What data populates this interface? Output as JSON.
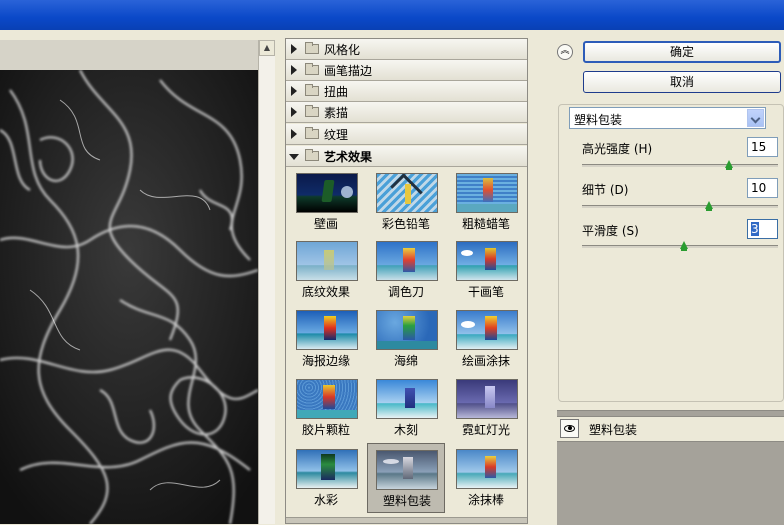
{
  "gallery": {
    "categories": [
      {
        "label": "风格化",
        "open": false
      },
      {
        "label": "画笔描边",
        "open": false
      },
      {
        "label": "扭曲",
        "open": false
      },
      {
        "label": "素描",
        "open": false
      },
      {
        "label": "纹理",
        "open": false
      },
      {
        "label": "艺术效果",
        "open": true
      }
    ],
    "thumbnails": [
      {
        "label": "壁画",
        "selected": false
      },
      {
        "label": "彩色铅笔",
        "selected": false
      },
      {
        "label": "粗糙蜡笔",
        "selected": false
      },
      {
        "label": "底纹效果",
        "selected": false
      },
      {
        "label": "调色刀",
        "selected": false
      },
      {
        "label": "干画笔",
        "selected": false
      },
      {
        "label": "海报边缘",
        "selected": false
      },
      {
        "label": "海绵",
        "selected": false
      },
      {
        "label": "绘画涂抹",
        "selected": false
      },
      {
        "label": "胶片颗粒",
        "selected": false
      },
      {
        "label": "木刻",
        "selected": false
      },
      {
        "label": "霓虹灯光",
        "selected": false
      },
      {
        "label": "水彩",
        "selected": false
      },
      {
        "label": "塑料包装",
        "selected": true
      },
      {
        "label": "涂抹棒",
        "selected": false
      }
    ]
  },
  "buttons": {
    "ok": "确定",
    "cancel": "取消"
  },
  "filter_select": {
    "value": "塑料包装"
  },
  "params": [
    {
      "label": "高光强度 (H)",
      "value": "15",
      "fraction": 0.75,
      "focused": false
    },
    {
      "label": "细节 (D)",
      "value": "10",
      "fraction": 0.65,
      "focused": false
    },
    {
      "label": "平滑度 (S)",
      "value": "3",
      "fraction": 0.52,
      "focused": true
    }
  ],
  "layers": [
    {
      "label": "塑料包装",
      "visible": true
    }
  ],
  "colors": {
    "titlebar": "#0a48c8",
    "panel": "#ece9d8",
    "slider_knob": "#2a9c30",
    "selection": "#316ac5"
  },
  "icons": {
    "collapse": "double-chevron-up-icon",
    "layer_visibility": "eye-icon",
    "category": "folder-icon"
  }
}
